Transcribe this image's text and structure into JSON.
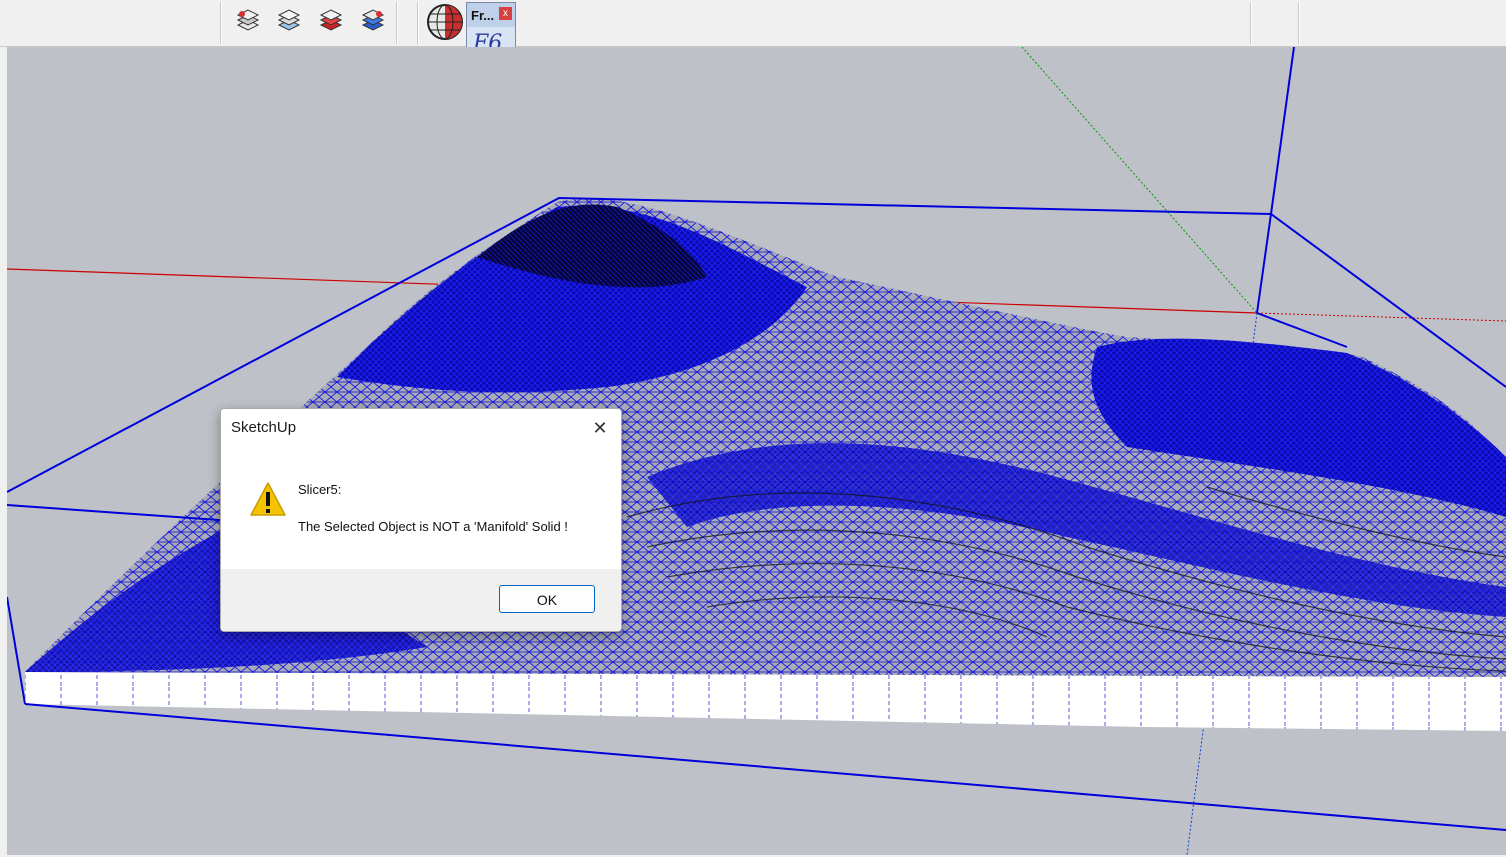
{
  "toolbar": {
    "icons": [
      "layer-stack-icon",
      "layer-stack-alt-icon",
      "layer-stack-red-icon",
      "layer-stack-blue-icon",
      "sphere-plugin-icon"
    ]
  },
  "floating_window": {
    "title": "Fr...",
    "close_label": "x",
    "f6_label": "F6"
  },
  "dialog": {
    "title": "SketchUp",
    "close_label": "✕",
    "heading": "Slicer5:",
    "message": "The Selected Object is NOT a 'Manifold' Solid !",
    "ok_label": "OK"
  },
  "colors": {
    "viewport_bg": "#bfc1c8",
    "mesh_blue": "#0000ff",
    "axis_red": "#cc0000",
    "axis_green": "#009900",
    "warning_yellow": "#f5c400"
  }
}
